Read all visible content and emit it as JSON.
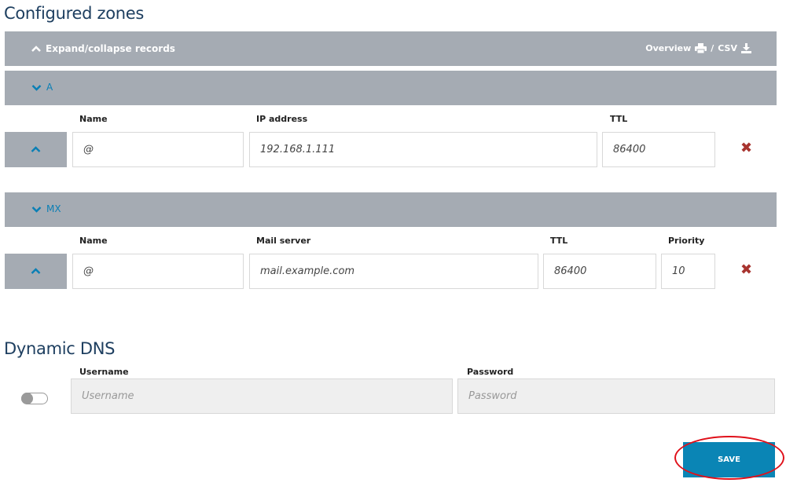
{
  "title": "Configured zones",
  "toolbar": {
    "expand_label": "Expand/collapse records",
    "overview_label": "Overview",
    "separator": "/",
    "csv_label": "CSV"
  },
  "groups": [
    {
      "type": "A",
      "columns": [
        "Name",
        "IP address",
        "TTL"
      ],
      "record": {
        "name": "@",
        "value": "192.168.1.111",
        "ttl": "86400"
      }
    },
    {
      "type": "MX",
      "columns": [
        "Name",
        "Mail server",
        "TTL",
        "Priority"
      ],
      "record": {
        "name": "@",
        "value": "mail.example.com",
        "ttl": "86400",
        "priority": "10"
      }
    }
  ],
  "ddns": {
    "title": "Dynamic DNS",
    "username_label": "Username",
    "username_placeholder": "Username",
    "password_label": "Password",
    "password_placeholder": "Password",
    "enabled": false
  },
  "save_label": "SAVE",
  "colors": {
    "accent": "#0a85b5",
    "bar": "#a5abb3",
    "delete": "#a8342f",
    "highlight": "#e0101a"
  }
}
